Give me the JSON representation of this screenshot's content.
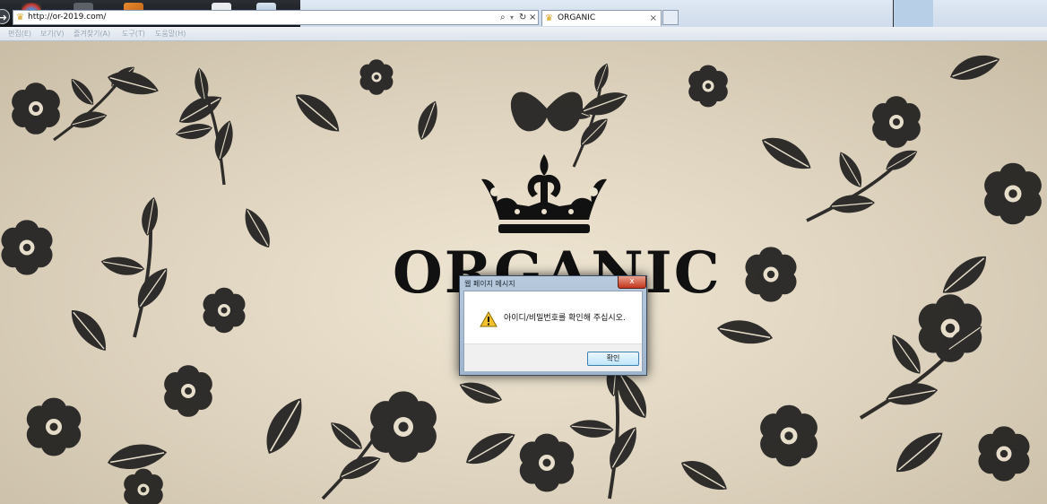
{
  "browser": {
    "address_url": "http://or-2019.com/",
    "tab_title": "ORGANIC",
    "tab_close": "×",
    "address_search_icon": "⌕",
    "address_refresh_icon": "↻",
    "address_stop_icon": "×"
  },
  "menu": {
    "items": [
      "편집(E)",
      "보기(V)",
      "즐겨찾기(A)",
      "도구(T)",
      "도움말(H)"
    ]
  },
  "page": {
    "logo_text": "ORGANIC"
  },
  "dialog": {
    "title": "웹 페이지 메시지",
    "close_label": "x",
    "message": "아이디/비밀번호를 확인해 주십시오.",
    "ok_label": "확인"
  },
  "colors": {
    "background": "#e8dfcc",
    "ink": "#111111",
    "dialog_frame": "#b7c9dd"
  }
}
